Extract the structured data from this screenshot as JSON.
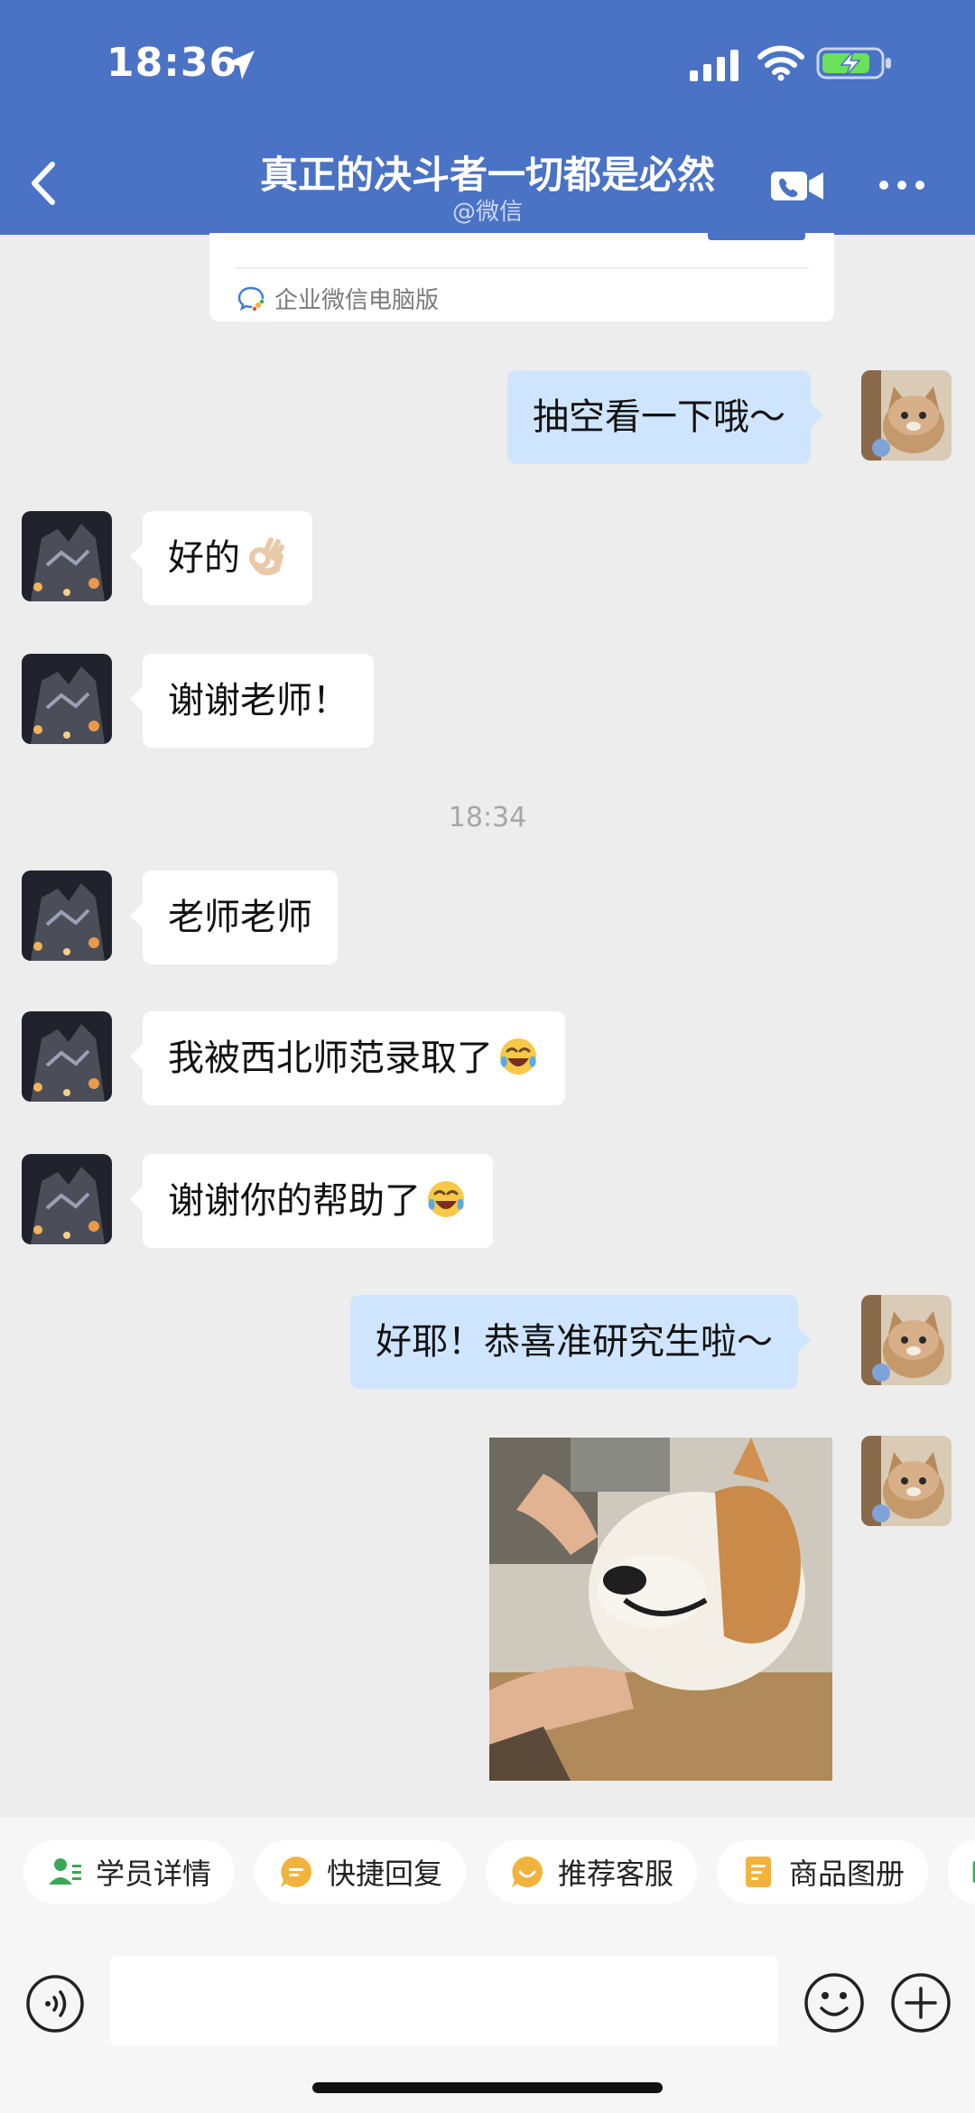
{
  "status_bar": {
    "time": "18:36"
  },
  "header": {
    "title": "真正的决斗者一切都是必然",
    "subtitle": "@微信"
  },
  "card": {
    "footer_text": "企业微信电脑版"
  },
  "messages": [
    {
      "side": "out",
      "text": "抽空看一下哦～"
    },
    {
      "side": "in",
      "text": "好的"
    },
    {
      "side": "in",
      "text": "谢谢老师！"
    },
    {
      "side": "in",
      "text": "老师老师"
    },
    {
      "side": "in",
      "text": "我被西北师范录取了"
    },
    {
      "side": "in",
      "text": "谢谢你的帮助了"
    },
    {
      "side": "out",
      "text": "好耶！恭喜准研究生啦～"
    }
  ],
  "timestamp": "18:34",
  "quick_actions": [
    {
      "label": "学员详情",
      "icon": "student-detail-icon",
      "color": "#3aa757"
    },
    {
      "label": "快捷回复",
      "icon": "quick-reply-icon",
      "color": "#f2b33d"
    },
    {
      "label": "推荐客服",
      "icon": "recommend-service-icon",
      "color": "#f2b33d"
    },
    {
      "label": "商品图册",
      "icon": "product-album-icon",
      "color": "#f2b33d"
    }
  ],
  "colors": {
    "header": "#4a72c5",
    "outgoing_bubble": "#cfe5fd",
    "incoming_bubble": "#ffffff",
    "background": "#ededed"
  }
}
